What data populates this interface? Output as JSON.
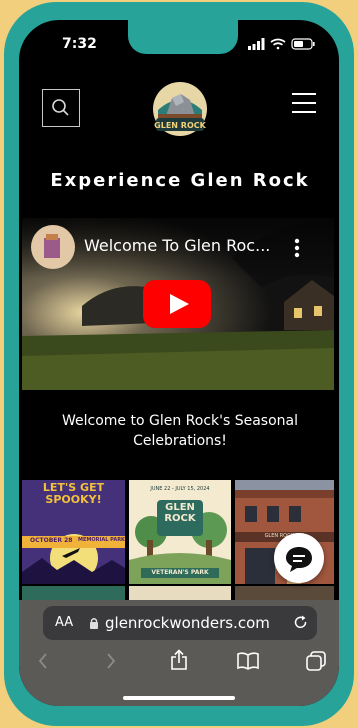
{
  "status": {
    "time": "7:32"
  },
  "header": {
    "logo_text": "GLEN ROCK",
    "headline": "Experience Glen Rock"
  },
  "video": {
    "title": "Welcome To Glen Roc..."
  },
  "caption": "Welcome to Glen Rock's Seasonal Celebrations!",
  "tiles": [
    {
      "title": "LET'S GET SPOOKY!",
      "date": "OCTOBER 28",
      "place": "MEMORIAL PARK"
    },
    {
      "title": "GLEN ROCK",
      "date": "JUNE 22 - JULY 15, 2024",
      "place": "VETERAN'S PARK"
    },
    {
      "sign": "GLEN ROCK INN"
    }
  ],
  "browser": {
    "aa_label": "AA",
    "url": "glenrockwonders.com"
  },
  "colors": {
    "frame": "#27a39a",
    "background": "#f2cf7d",
    "play": "#ff0000"
  }
}
